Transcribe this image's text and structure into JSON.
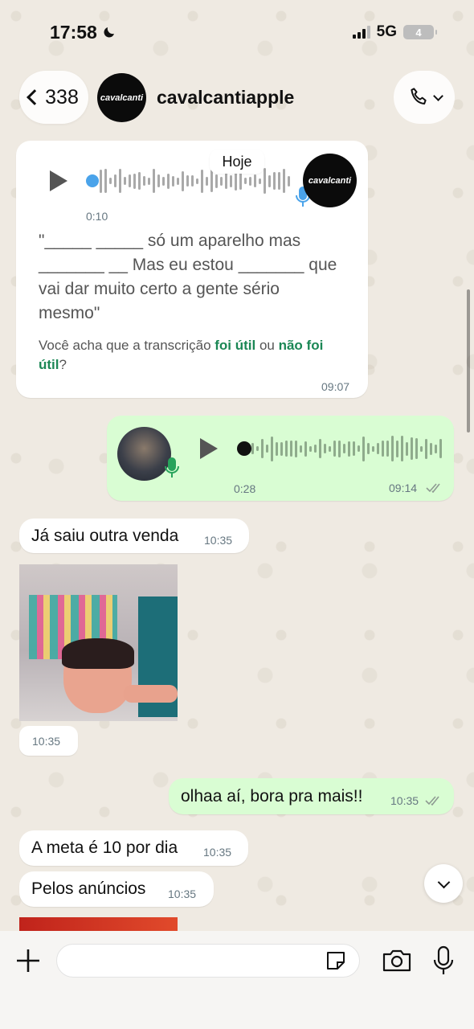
{
  "status": {
    "time": "17:58",
    "network": "5G",
    "battery": "4"
  },
  "header": {
    "back_count": "338",
    "contact_name": "cavalcantiapple",
    "avatar_text": "cavalcanti"
  },
  "date_chip": "Hoje",
  "messages": {
    "voice_in": {
      "duration": "0:10",
      "transcript": "\"_____ _____ só um aparelho mas _______ __ Mas eu estou _______ que vai dar muito certo a gente sério mesmo\"",
      "feedback_prefix": "Você acha que a transcrição ",
      "feedback_yes": "foi útil",
      "feedback_mid": " ou ",
      "feedback_no": "não foi útil",
      "feedback_suffix": "?",
      "time": "09:07"
    },
    "voice_out": {
      "duration": "0:28",
      "time": "09:14"
    },
    "text1": {
      "text": "Já saiu outra venda",
      "time": "10:35"
    },
    "photo_time": "10:35",
    "text2": {
      "text": "olhaa aí, bora pra mais!!",
      "time": "10:35"
    },
    "text3": {
      "text": "A meta é 10 por dia",
      "time": "10:35"
    },
    "text4": {
      "text": "Pelos anúncios",
      "time": "10:35"
    }
  },
  "colors": {
    "accent_green": "#1b8755",
    "out_bubble": "#d9fdd3",
    "mic_blue": "#4aa3ea"
  },
  "icons": [
    "moon-icon",
    "chevron-left-icon",
    "phone-icon",
    "play-icon",
    "mic-icon",
    "check-double-icon",
    "chevron-down-icon",
    "plus-icon",
    "sticker-icon",
    "camera-icon"
  ]
}
